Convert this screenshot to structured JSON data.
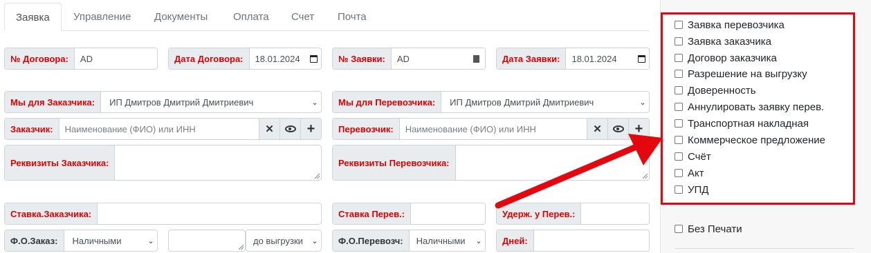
{
  "tabs": [
    "Заявка",
    "Управление",
    "Документы",
    "Оплата",
    "Счет",
    "Почта"
  ],
  "form": {
    "contract_no_label": "№ Договора:",
    "contract_no_value": "AD",
    "contract_date_label": "Дата Договора:",
    "contract_date_value": "18.01.2024",
    "request_no_label": "№ Заявки:",
    "request_no_value": "AD",
    "request_date_label": "Дата Заявки:",
    "request_date_value": "18.01.2024",
    "we_for_customer_label": "Мы для Заказчика:",
    "we_for_customer_value": "ИП Дмитров Дмитрий Дмитриевич",
    "we_for_carrier_label": "Мы для Перевозчика:",
    "we_for_carrier_value": "ИП Дмитров Дмитрий Дмитриевич",
    "customer_label": "Заказчик:",
    "customer_placeholder": "Наименование (ФИО) или ИНН",
    "carrier_label": "Перевозчик:",
    "carrier_placeholder": "Наименование (ФИО) или ИНН",
    "customer_details_label": "Реквизиты Заказчика:",
    "carrier_details_label": "Реквизиты Перевозчика:",
    "customer_rate_label": "Ставка.Заказчика:",
    "carrier_rate_label": "Ставка Перев.:",
    "carrier_withheld_label": "Удерж. у Перев.:",
    "customer_pay_form_label": "Ф.О.Заказ:",
    "customer_pay_form_value": "Наличными",
    "customer_pay_term_value": "до выгрузки",
    "carrier_pay_form_label": "Ф.О.Перевозч:",
    "carrier_pay_form_value": "Наличными",
    "days_label": "Дней:"
  },
  "documents": [
    "Заявка перевозчика",
    "Заявка заказчика",
    "Договор заказчика",
    "Разрешение на выгрузку",
    "Доверенность",
    "Аннулировать заявку перев.",
    "Транспортная накладная",
    "Коммерческое предложение",
    "Счёт",
    "Акт",
    "УПД"
  ],
  "no_print_label": "Без Печати",
  "colors": {
    "label_red": "#e00000",
    "highlight_red": "#e4070e",
    "label_bg": "#e9ecef"
  }
}
